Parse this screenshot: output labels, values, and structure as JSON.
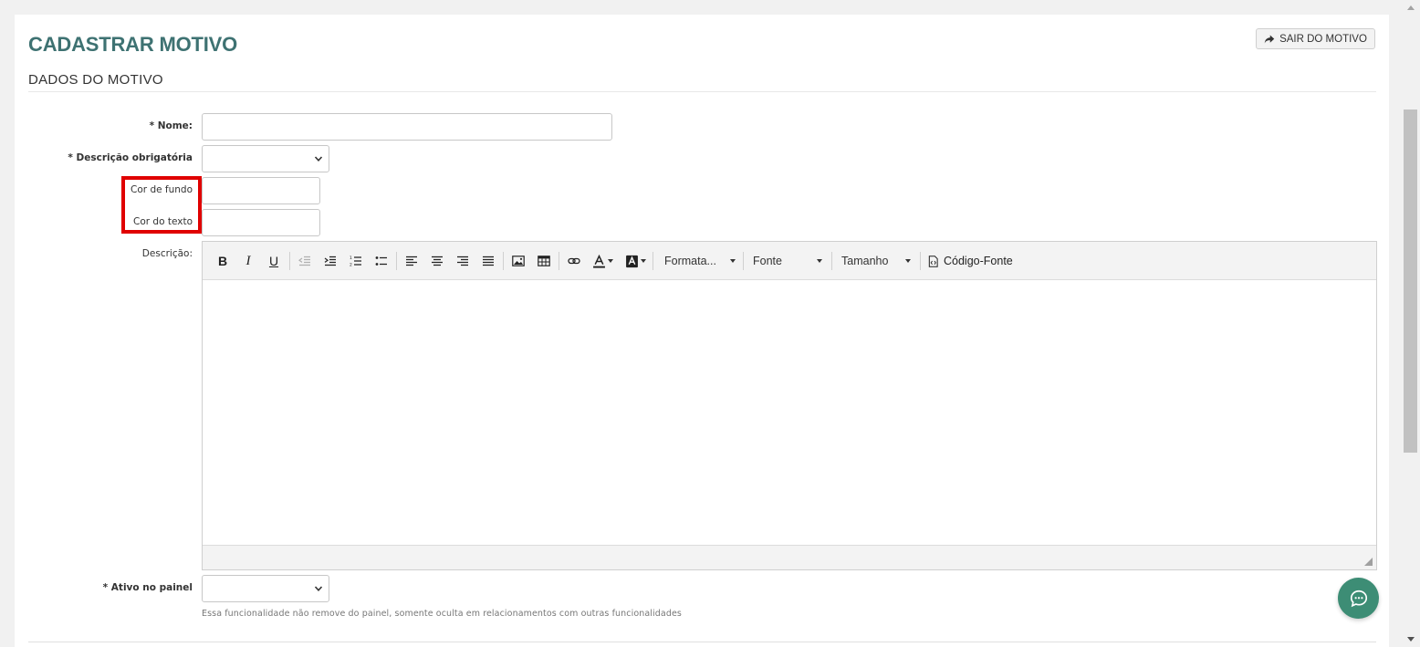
{
  "header": {
    "title": "CADASTRAR MOTIVO",
    "exit_button": "SAIR DO MOTIVO"
  },
  "section": {
    "title": "DADOS DO MOTIVO"
  },
  "form": {
    "required_mark": "*",
    "nome_label": "Nome:",
    "nome_value": "",
    "descricao_obrigatoria_label": "Descrição obrigatória",
    "descricao_obrigatoria_value": "",
    "cor_fundo_label": "Cor de fundo",
    "cor_fundo_value": "",
    "cor_texto_label": "Cor do texto",
    "cor_texto_value": "",
    "descricao_label": "Descrição:",
    "ativo_painel_label": "Ativo no painel",
    "ativo_painel_value": "",
    "ativo_painel_help": "Essa funcionalidade não remove do painel, somente oculta em relacionamentos com outras funcionalidades"
  },
  "editor": {
    "toolbar": {
      "bold": "B",
      "italic": "I",
      "underline": "U",
      "format_dropdown": "Formata...",
      "font_dropdown": "Fonte",
      "size_dropdown": "Tamanho",
      "source_code": "Código-Fonte"
    }
  },
  "colors": {
    "title": "#3e7272",
    "highlight": "#e00000",
    "chat": "#3d8d75"
  },
  "icons": [
    "share-icon",
    "chevron-down-icon",
    "outdent-icon",
    "indent-icon",
    "numbered-list-icon",
    "bullet-list-icon",
    "align-left-icon",
    "align-center-icon",
    "align-right-icon",
    "align-justify-icon",
    "image-icon",
    "table-icon",
    "link-icon",
    "text-color-icon",
    "background-color-icon",
    "source-code-icon",
    "resize-handle-icon",
    "chat-icon"
  ]
}
